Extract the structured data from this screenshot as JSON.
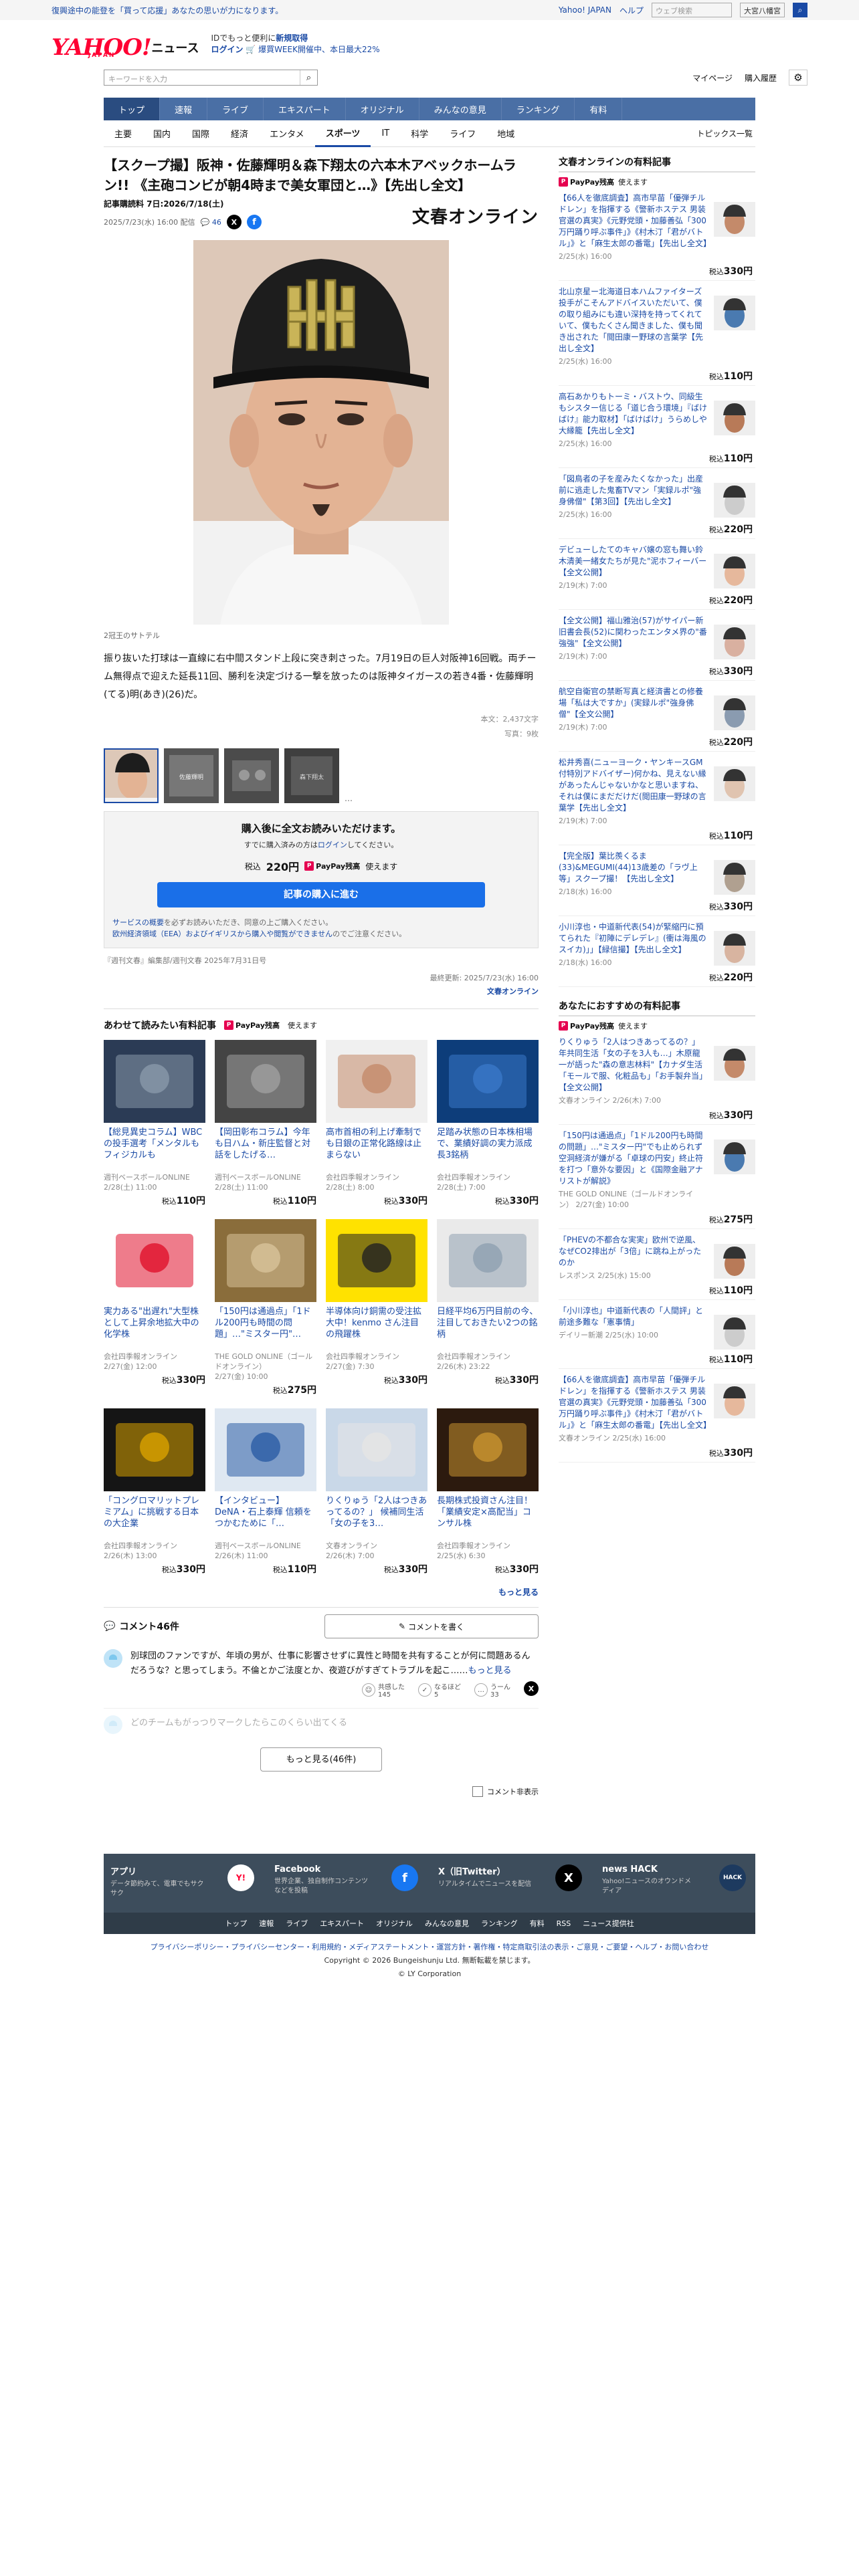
{
  "announce": {
    "notice": "復興途中の能登を「買って応援」あなたの思いが力になります。",
    "links": [
      "Yahoo! JAPAN",
      "ヘルプ"
    ],
    "weather_placeholder": "ウェブ検索",
    "weather_place": "大宮八幡宮"
  },
  "mast": {
    "logo_main": "YAHOO!",
    "logo_sub": "JAPAN",
    "logo_news": "ニュース",
    "promo_line1_pre": "IDでもっと便利に",
    "promo_line1_bold": "新規取得",
    "promo_login": "ログイン",
    "promo_line2": "🛒 爆買WEEK開催中、本日最大22%"
  },
  "search": {
    "placeholder": "キーワードを入力",
    "mypage": "マイページ",
    "history": "購入履歴"
  },
  "gnav": [
    "トップ",
    "速報",
    "ライブ",
    "エキスパート",
    "オリジナル",
    "みんなの意見",
    "ランキング",
    "有料"
  ],
  "snav": [
    "主要",
    "国内",
    "国際",
    "経済",
    "エンタメ",
    "スポーツ",
    "IT",
    "科学",
    "ライフ",
    "地域"
  ],
  "snav_right": "トピックス一覧",
  "article": {
    "title": "【スクープ撮】阪神・佐藤輝明＆森下翔太の六本木アベックホームラン!! 《主砲コンビが朝4時まで美女軍団と…》【先出し全文】",
    "subscribe": "記事購読料 7日:2026/7/18(土)",
    "date": "2025/7/23(水) 16:00 配信",
    "comment_count": "46",
    "publisher": "文春オンライン",
    "caption": "2冠王のサトテル",
    "lead": "振り抜いた打球は一直線に右中間スタンド上段に突き刺さった。7月19日の巨人対阪神16回戦。両チーム無得点で迎えた延長11回、勝利を決定づける一撃を放ったのは阪神タイガースの若き4番・佐藤輝明(てる)明(あき)(26)だ。",
    "stats_1": "本文：2,437文字",
    "stats_2": "写真：9枚",
    "thumb_labels": [
      "佐藤輝明",
      "森下翔太"
    ]
  },
  "buy": {
    "title": "購入後に全文お読みいただけます。",
    "login_pre": "すでに購入済みの方は",
    "login_link": "ログイン",
    "login_post": "してください。",
    "price_label": "税込",
    "price": "220円",
    "paypay": "PayPay残高",
    "paypay_post": "使えます",
    "button": "記事の購入に進む",
    "notes_pre": "サービスの概要",
    "notes_1": "を必ずお読みいただき、同意の上ご購入ください。",
    "notes_2": "欧州経済領域（EEA）およびイギリスから購入や閲覧ができません",
    "notes_3": "のでご注意ください。"
  },
  "copyright_line": "『週刊文春』編集部/週刊文春 2025年7月31日号",
  "final_update": "最終更新: 2025/7/23(水) 16:00",
  "final_pub": "文春オンライン",
  "recommended": {
    "title": "あわせて読みたい有料記事",
    "paypay": "PayPay残高",
    "paypay_post": "使えます",
    "more": "もっと見る",
    "cards": [
      {
        "title": "【総見異史コラム】WBCの投手選考「メンタルもフィジカルも",
        "source": "週刊ベースボールONLINE",
        "date": "2/28(土) 11:00",
        "price": "110円"
      },
      {
        "title": "【岡田彰布コラム】今年も日ハム・新庄監督と対話をしたげる…",
        "source": "週刊ベースボールONLINE",
        "date": "2/28(土) 11:00",
        "price": "110円"
      },
      {
        "title": "高市首相の利上げ牽制でも日銀の正常化路線は止まらない",
        "source": "会社四季報オンライン",
        "date": "2/28(土) 8:00",
        "price": "330円"
      },
      {
        "title": "足踏み状態の日本株相場で、業績好調の実力派成長3銘柄",
        "source": "会社四季報オンライン",
        "date": "2/28(土) 7:00",
        "price": "330円"
      },
      {
        "title": "実力ある\"出遅れ\"大型株として上昇余地拡大中の化学株",
        "source": "会社四季報オンライン",
        "date": "2/27(金) 12:00",
        "price": "330円"
      },
      {
        "title": "「150円は通過点」「1ドル200円も時間の問題」…\"ミスター円\"…",
        "source": "THE GOLD ONLINE（ゴールドオンライン）",
        "date": "2/27(金) 10:00",
        "price": "275円"
      },
      {
        "title": "半導体向け銅需の受注拡大中！kenmo さん注目の飛躍株",
        "source": "会社四季報オンライン",
        "date": "2/27(金) 7:30",
        "price": "330円"
      },
      {
        "title": "日経平均6万円目前の今、注目しておきたい2つの銘柄",
        "source": "会社四季報オンライン",
        "date": "2/26(木) 23:22",
        "price": "330円"
      },
      {
        "title": "「コングロマリットプレミアム」に挑戦する日本の大企業",
        "source": "会社四季報オンライン",
        "date": "2/26(木) 13:00",
        "price": "330円"
      },
      {
        "title": "【インタビュー】DeNA・石上泰輝 信頼をつかむために「…",
        "source": "週刊ベースボールONLINE",
        "date": "2/26(木) 11:00",
        "price": "110円"
      },
      {
        "title": "りくりゅう「2人はつきあってるの？」 候補同生活「女の子を3…",
        "source": "文春オンライン",
        "date": "2/26(木) 7:00",
        "price": "330円"
      },
      {
        "title": "長期株式投資さん注目！「業績安定×高配当」コンサル株",
        "source": "会社四季報オンライン",
        "date": "2/25(水) 6:30",
        "price": "330円"
      }
    ]
  },
  "comments": {
    "title": "コメント46件",
    "write": "コメントを書く",
    "body": "別球団のファンですが、年頃の男が、仕事に影響させずに異性と時間を共有することが何に問題あるんだろうな？と思ってしまう。不倫とかご法度とか、夜遊びがすぎてトラブルを起こ……",
    "more": "もっと見る",
    "react_1_label": "共感した",
    "react_1": "145",
    "react_2_label": "なるほど",
    "react_2": "5",
    "react_3_label": "うーん",
    "react_3": "33",
    "faded": "どのチームもがっつりマークしたらこのくらい出てくる",
    "more_button": "もっと見る(46件)",
    "hide": "コメント非表示"
  },
  "sidebar": {
    "title": "文春オンラインの有料記事",
    "paypay": "PayPay残高",
    "paypay_post": "使えます",
    "items": [
      {
        "title": "【66人を徹底調査】高市早苗「優弾チルドレン」を指揮する《警新ホステス 男装官選の真実》《元野党頭・加藤善弘「300万円踊り呼ぶ事件」》《村木汀「君がバトル」》と「麻生太郎の番電」【先出し全文】",
        "date": "2/25(水) 16:00",
        "price": "330円"
      },
      {
        "title": "北山京星ー北海道日本ハムファイターズ投手がこそんアドバイスいただいて、僕の取り組みにも違い深持を持ってくれていて、僕もたくさん聞きました、僕も聞き出された「閲田康ー野球の言葉学【先出し全文】",
        "date": "2/25(水) 16:00",
        "price": "110円"
      },
      {
        "title": "高石あかりもトーミ・バストウ、同級生もシスター信じる「道じ合う環境」『ばけばけ』能力取材】「ばけばけ」うらめしや大縁籠【先出し全文】",
        "date": "2/25(水) 16:00",
        "price": "110円"
      },
      {
        "title": "「図鳥者の子を産みたくなかった」出産前に逃走した鬼畜TVマン「実録ルポ\"強身佛僧\"【第3回】【先出し全文】",
        "date": "2/25(水) 16:00",
        "price": "220円"
      },
      {
        "title": "デビューしたてのキャバ嬢の窓も舞い鈴木清美一緒女たちが見た\"泥ホフィーバー【全文公開】",
        "date": "2/19(木) 7:00",
        "price": "220円"
      },
      {
        "title": "【全文公開】福山雅治(57)がサイパー新旧書会長(52)に関わったエンタメ界の\"番強強\"【全文公開】",
        "date": "2/19(木) 7:00",
        "price": "330円"
      },
      {
        "title": "航空自衛官の禁断写真と経済書との修養場「私は大ですか」(実録ルポ\"強身佛僧\"【全文公開】",
        "date": "2/19(木) 7:00",
        "price": "220円"
      },
      {
        "title": "松井秀喜(ニューヨーク・ヤンキースGM付特別アドバイザー)何かね、見えない縁があったんじゃないかなと思いますね、それは僕にまだだけだ(閲田康一野球の言葉学【先出し全文】",
        "date": "2/19(木) 7:00",
        "price": "110円"
      },
      {
        "title": "【完全版】葉比羨くるま(33)&MEGUMI(44)13歳差の「ラヴ上等」スクープ撮！【先出し全文】",
        "date": "2/18(水) 16:00",
        "price": "330円"
      },
      {
        "title": "小川淳也・中道新代表(54)が緊縮円に預てられた『初陣にデレデレ』(衝は海風のスイカ)」」【緑信撮】【先出し全文】",
        "date": "2/18(水) 16:00",
        "price": "220円"
      }
    ],
    "rec_title": "あなたにおすすめの有料記事",
    "rec_items": [
      {
        "title": "りくりゅう「2人はつきあってるの？」 年共同生活「女の子を3人も…」木原龍一が語った\"森の意志林料\"【カナダ生活「モールで服、化粧品も」「お手製弁当」【全文公開】",
        "date": "文春オンライン 2/26(木) 7:00",
        "price": "330円"
      },
      {
        "title": "「150円は通過点」「1ドル200円も時間の問題」…\"ミスター円\"でも止められず空洞経済が嫌がる「卓球の円安」終止符を打つ「意外な要因」と《国際金融アナリストが解説》",
        "date": "THE GOLD ONLINE（ゴールドオンライン） 2/27(金) 10:00",
        "price": "275円"
      },
      {
        "title": "「PHEVの不都合な実実」欧州で逆風、なぜCO2排出が「3倍」に跳ね上がったのか",
        "date": "レスポンス 2/25(水) 15:00",
        "price": "110円"
      },
      {
        "title": "「小川淳也」中道新代表の「人間評」と前途多難な「憲事情」",
        "date": "デイリー新潮 2/25(水) 10:00",
        "price": "110円"
      },
      {
        "title": "【66人を徹底調査】高市早苗「優弾チルドレン」を指揮する《警新ホステス 男装官選の真実》《元野党頭・加藤善弘「300万円踊り呼ぶ事件」》《村木汀「君がバトル」》と「麻生太郎の番電」【先出し全文】",
        "date": "文春オンライン 2/25(水) 16:00",
        "price": "330円"
      }
    ]
  },
  "footer": {
    "cols": [
      {
        "title": "アプリ",
        "desc": "データ節約みて、電車でもサクサク",
        "icon": "app-icon"
      },
      {
        "title": "Facebook",
        "desc": "世界企業、独自制作コンテンツなどを投稿",
        "icon": "facebook-icon"
      },
      {
        "title": "X（旧Twitter）",
        "desc": "リアルタイムでニュースを配信",
        "icon": "x-icon"
      },
      {
        "title": "news HACK",
        "desc": "Yahoo!ニュースのオウンドメディア",
        "icon": "newshack-icon"
      }
    ],
    "links": [
      "トップ",
      "速報",
      "ライブ",
      "エキスパート",
      "オリジナル",
      "みんなの意見",
      "ランキング",
      "有料",
      "RSS",
      "ニュース提供社"
    ],
    "legal_links": "プライバシーポリシー・プライバシーセンター・利用規約・メディアステートメント・運営方針・著作権・特定商取引法の表示・ご意見・ご要望・ヘルプ・お問い合わせ",
    "copyright": "Copyright © 2026 Bungeishunju Ltd. 無断転載を禁じます。",
    "company": "© LY Corporation"
  },
  "colors": {
    "accent": "#1a4aa5",
    "nav": "#4a6fa5",
    "buy_button": "#1a6fe8",
    "footer": "#3d4d5c"
  }
}
